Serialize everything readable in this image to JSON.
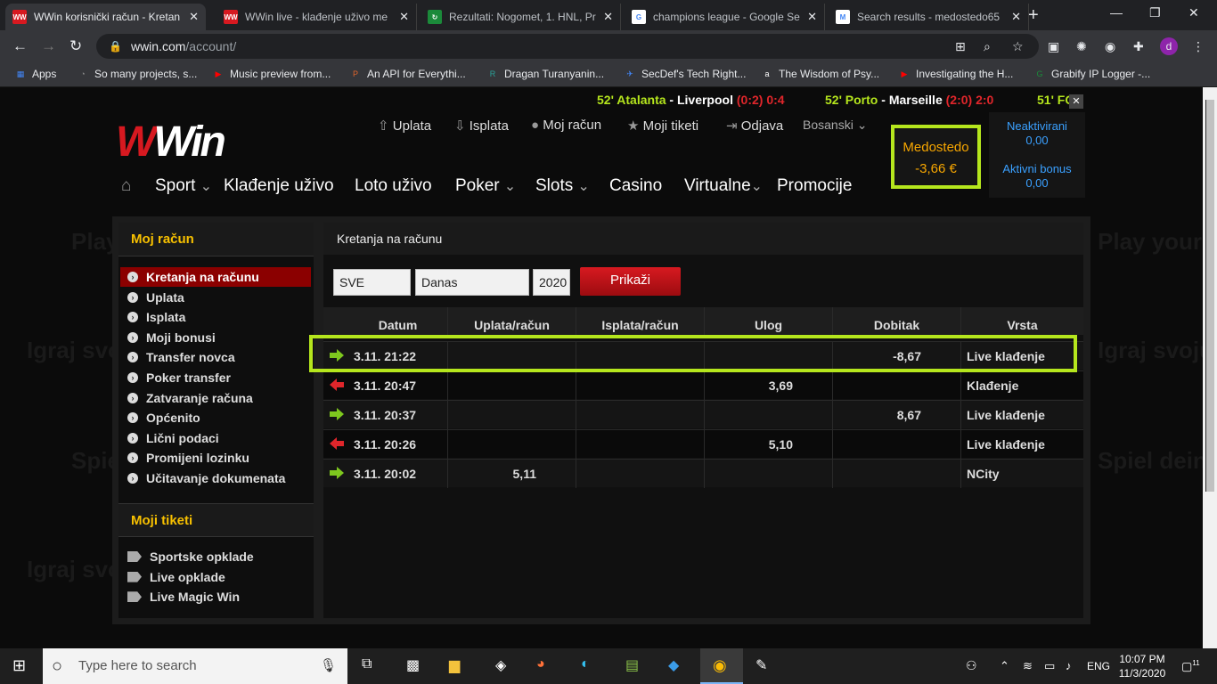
{
  "tabs": [
    {
      "title": "WWin korisnički račun - Kretan",
      "fav": "WW",
      "favbg": "#d71920"
    },
    {
      "title": "WWin live - klađenje uživo me",
      "fav": "WW",
      "favbg": "#d71920"
    },
    {
      "title": "Rezultati: Nogomet, 1. HNL, Pr",
      "fav": "↻",
      "favbg": "#1b8a3a"
    },
    {
      "title": "champions league - Google Se",
      "fav": "G",
      "favbg": "#fff"
    },
    {
      "title": "Search results - medostedo65",
      "fav": "M",
      "favbg": "#fff"
    }
  ],
  "url": {
    "domain": "wwin.com",
    "path": "/account/"
  },
  "bookmarks": [
    "Apps",
    "So many projects, s...",
    "Music preview from...",
    "An API for Everythi...",
    "Dragan Turanyanin...",
    "SecDef's Tech Right...",
    "The Wisdom of Psy...",
    "Investigating the H...",
    "Grabify IP Logger -..."
  ],
  "ticker": [
    {
      "min": "52'",
      "home": "Atalanta",
      "away": "Liverpool",
      "ht": "(0:2)",
      "score": "0:4"
    },
    {
      "min": "52'",
      "home": "Porto",
      "away": "Marseille",
      "ht": "(2:0)",
      "score": "2:0"
    },
    {
      "min": "51'",
      "home": "FC",
      "away": "",
      "ht": "",
      "score": ""
    }
  ],
  "logo": {
    "w": "W",
    "rest": "Win"
  },
  "topmenu": [
    "Uplata",
    "Isplata",
    "Moj račun",
    "Moji tiketi",
    "Odjava",
    "Bosanski"
  ],
  "mainnav": [
    "Sport",
    "Klađenje uživo",
    "Loto uživo",
    "Poker",
    "Slots",
    "Casino",
    "Virtualne",
    "Promocije"
  ],
  "balance": {
    "user": "Medostedo",
    "amount": "-3,66 €"
  },
  "bonus": {
    "inactive_label": "Neaktivirani",
    "inactive_val": "0,00",
    "active_label": "Aktivni bonus",
    "active_val": "0,00"
  },
  "bgtext": [
    "Play",
    "Play your",
    "Igraj svoju igru",
    "Igraj svoju igru!",
    "Spiel",
    "Spiel dein",
    "Igraj svoju igru"
  ],
  "sidebar": {
    "title": "Moj račun",
    "items": [
      "Kretanja na računu",
      "Uplata",
      "Isplata",
      "Moji bonusi",
      "Transfer novca",
      "Poker transfer",
      "Zatvaranje računa",
      "Općenito",
      "Lični podaci",
      "Promijeni lozinku",
      "Učitavanje dokumenata"
    ],
    "tickets_title": "Moji tiketi",
    "tickets": [
      "Sportske opklade",
      "Live opklade",
      "Live Magic Win"
    ]
  },
  "content": {
    "title": "Kretanja na računu",
    "filter_type": "SVE",
    "filter_period": "Danas",
    "filter_year": "2020",
    "show_button": "Prikaži",
    "headers": [
      "Datum",
      "Uplata/račun",
      "Isplata/račun",
      "Ulog",
      "Dobitak",
      "Vrsta"
    ],
    "rows": [
      {
        "dir": "in",
        "date": "3.11. 21:22",
        "uplata": "",
        "isplata": "",
        "ulog": "",
        "dobitak": "-8,67",
        "vrsta": "Live klađenje"
      },
      {
        "dir": "out",
        "date": "3.11. 20:47",
        "uplata": "",
        "isplata": "",
        "ulog": "3,69",
        "dobitak": "",
        "vrsta": "Klađenje"
      },
      {
        "dir": "in",
        "date": "3.11. 20:37",
        "uplata": "",
        "isplata": "",
        "ulog": "",
        "dobitak": "8,67",
        "vrsta": "Live klađenje"
      },
      {
        "dir": "out",
        "date": "3.11. 20:26",
        "uplata": "",
        "isplata": "",
        "ulog": "5,10",
        "dobitak": "",
        "vrsta": "Live klađenje"
      },
      {
        "dir": "in",
        "date": "3.11. 20:02",
        "uplata": "5,11",
        "isplata": "",
        "ulog": "",
        "dobitak": "",
        "vrsta": "NCity"
      }
    ]
  },
  "taskbar": {
    "search": "Type here to search",
    "lang": "ENG",
    "time": "10:07 PM",
    "date": "11/3/2020",
    "notif": "11"
  },
  "colors": {
    "accent_red": "#d71920",
    "highlight": "#b5e61d",
    "gold": "#f7a600",
    "arrow_in": "#7ec81e",
    "arrow_out": "#e0262b"
  }
}
